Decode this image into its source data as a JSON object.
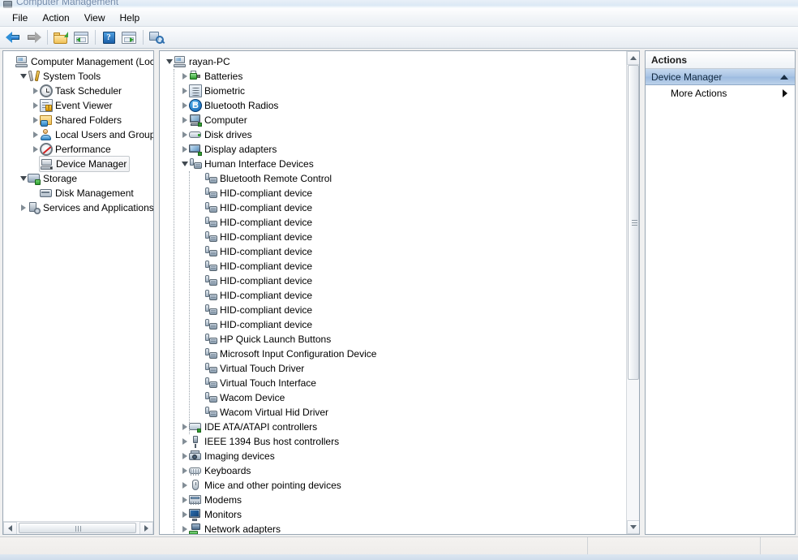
{
  "window": {
    "title": "Computer Management",
    "title_icon": "computer-management-icon"
  },
  "menubar": {
    "items": [
      {
        "label": "File",
        "name": "menu-file"
      },
      {
        "label": "Action",
        "name": "menu-action"
      },
      {
        "label": "View",
        "name": "menu-view"
      },
      {
        "label": "Help",
        "name": "menu-help"
      }
    ]
  },
  "toolbar": {
    "buttons": [
      {
        "name": "back-button",
        "icon": "back-arrow-icon",
        "tooltip": "Back"
      },
      {
        "name": "forward-button",
        "icon": "forward-arrow-icon",
        "tooltip": "Forward"
      },
      {
        "name": "up-one-level-button",
        "icon": "folder-up-icon",
        "tooltip": "Up One Level"
      },
      {
        "name": "show-hide-console-tree-button",
        "icon": "console-tree-icon",
        "tooltip": "Show/Hide Console Tree"
      },
      {
        "name": "help-button",
        "icon": "help-question-icon",
        "tooltip": "Help"
      },
      {
        "name": "show-hide-action-pane-button",
        "icon": "action-pane-icon",
        "tooltip": "Show/Hide Action Pane"
      },
      {
        "name": "scan-for-hardware-changes-button",
        "icon": "scan-hardware-icon",
        "tooltip": "Scan for hardware changes"
      }
    ]
  },
  "console_tree": {
    "items": [
      {
        "label": "Computer Management (Local",
        "icon": "computer-management-icon",
        "depth": 0,
        "state": "none",
        "selected": false
      },
      {
        "label": "System Tools",
        "icon": "system-tools-icon",
        "depth": 1,
        "state": "expanded",
        "selected": false
      },
      {
        "label": "Task Scheduler",
        "icon": "task-scheduler-icon",
        "depth": 2,
        "state": "collapsed",
        "selected": false
      },
      {
        "label": "Event Viewer",
        "icon": "event-viewer-icon",
        "depth": 2,
        "state": "collapsed",
        "selected": false
      },
      {
        "label": "Shared Folders",
        "icon": "shared-folders-icon",
        "depth": 2,
        "state": "collapsed",
        "selected": false
      },
      {
        "label": "Local Users and Groups",
        "icon": "local-users-groups-icon",
        "depth": 2,
        "state": "collapsed",
        "selected": false
      },
      {
        "label": "Performance",
        "icon": "performance-icon",
        "depth": 2,
        "state": "collapsed",
        "selected": false
      },
      {
        "label": "Device Manager",
        "icon": "device-manager-icon",
        "depth": 2,
        "state": "none",
        "selected": true
      },
      {
        "label": "Storage",
        "icon": "storage-icon",
        "depth": 1,
        "state": "expanded",
        "selected": false
      },
      {
        "label": "Disk Management",
        "icon": "disk-management-icon",
        "depth": 2,
        "state": "none",
        "selected": false
      },
      {
        "label": "Services and Applications",
        "icon": "services-applications-icon",
        "depth": 1,
        "state": "collapsed",
        "selected": false
      }
    ]
  },
  "device_tree": {
    "root": {
      "label": "rayan-PC",
      "icon": "computer-node-icon",
      "state": "expanded"
    },
    "items": [
      {
        "label": "Batteries",
        "icon": "batteries-icon",
        "depth": 1,
        "state": "collapsed"
      },
      {
        "label": "Biometric",
        "icon": "biometric-icon",
        "depth": 1,
        "state": "collapsed"
      },
      {
        "label": "Bluetooth Radios",
        "icon": "bluetooth-icon",
        "depth": 1,
        "state": "collapsed"
      },
      {
        "label": "Computer",
        "icon": "computer-icon",
        "depth": 1,
        "state": "collapsed"
      },
      {
        "label": "Disk drives",
        "icon": "disk-drives-icon",
        "depth": 1,
        "state": "collapsed"
      },
      {
        "label": "Display adapters",
        "icon": "display-adapters-icon",
        "depth": 1,
        "state": "collapsed"
      },
      {
        "label": "Human Interface Devices",
        "icon": "hid-icon",
        "depth": 1,
        "state": "expanded"
      },
      {
        "label": "Bluetooth Remote Control",
        "icon": "hid-device-icon",
        "depth": 2,
        "state": "leaf"
      },
      {
        "label": "HID-compliant device",
        "icon": "hid-device-icon",
        "depth": 2,
        "state": "leaf"
      },
      {
        "label": "HID-compliant device",
        "icon": "hid-device-icon",
        "depth": 2,
        "state": "leaf"
      },
      {
        "label": "HID-compliant device",
        "icon": "hid-device-icon",
        "depth": 2,
        "state": "leaf"
      },
      {
        "label": "HID-compliant device",
        "icon": "hid-device-icon",
        "depth": 2,
        "state": "leaf"
      },
      {
        "label": "HID-compliant device",
        "icon": "hid-device-icon",
        "depth": 2,
        "state": "leaf"
      },
      {
        "label": "HID-compliant device",
        "icon": "hid-device-icon",
        "depth": 2,
        "state": "leaf"
      },
      {
        "label": "HID-compliant device",
        "icon": "hid-device-icon",
        "depth": 2,
        "state": "leaf"
      },
      {
        "label": "HID-compliant device",
        "icon": "hid-device-icon",
        "depth": 2,
        "state": "leaf"
      },
      {
        "label": "HID-compliant device",
        "icon": "hid-device-icon",
        "depth": 2,
        "state": "leaf"
      },
      {
        "label": "HID-compliant device",
        "icon": "hid-device-icon",
        "depth": 2,
        "state": "leaf"
      },
      {
        "label": "HP Quick Launch Buttons",
        "icon": "hid-device-icon",
        "depth": 2,
        "state": "leaf"
      },
      {
        "label": "Microsoft Input Configuration Device",
        "icon": "hid-device-icon",
        "depth": 2,
        "state": "leaf"
      },
      {
        "label": "Virtual Touch Driver",
        "icon": "hid-device-icon",
        "depth": 2,
        "state": "leaf"
      },
      {
        "label": "Virtual Touch Interface",
        "icon": "hid-device-icon",
        "depth": 2,
        "state": "leaf"
      },
      {
        "label": "Wacom Device",
        "icon": "hid-device-icon",
        "depth": 2,
        "state": "leaf"
      },
      {
        "label": "Wacom Virtual Hid Driver",
        "icon": "hid-device-icon",
        "depth": 2,
        "state": "leaf"
      },
      {
        "label": "IDE ATA/ATAPI controllers",
        "icon": "ide-controllers-icon",
        "depth": 1,
        "state": "collapsed"
      },
      {
        "label": "IEEE 1394 Bus host controllers",
        "icon": "ieee1394-icon",
        "depth": 1,
        "state": "collapsed"
      },
      {
        "label": "Imaging devices",
        "icon": "imaging-devices-icon",
        "depth": 1,
        "state": "collapsed"
      },
      {
        "label": "Keyboards",
        "icon": "keyboards-icon",
        "depth": 1,
        "state": "collapsed"
      },
      {
        "label": "Mice and other pointing devices",
        "icon": "mice-icon",
        "depth": 1,
        "state": "collapsed"
      },
      {
        "label": "Modems",
        "icon": "modems-icon",
        "depth": 1,
        "state": "collapsed"
      },
      {
        "label": "Monitors",
        "icon": "monitors-icon",
        "depth": 1,
        "state": "collapsed"
      },
      {
        "label": "Network adapters",
        "icon": "network-adapters-icon",
        "depth": 1,
        "state": "collapsed"
      }
    ]
  },
  "actions_pane": {
    "header": "Actions",
    "group_title": "Device Manager",
    "group_collapse_icon": "chevron-up-icon",
    "items": [
      {
        "label": "More Actions",
        "name": "action-more-actions",
        "submenu_icon": "chevron-right-icon"
      }
    ]
  },
  "statusbar": {
    "text": ""
  },
  "colors": {
    "accent_blue": "#a9c4e4",
    "pane_border": "#9aa7b4",
    "toolbar_bg": "#f1f4f8",
    "tree_text": "#000000"
  }
}
